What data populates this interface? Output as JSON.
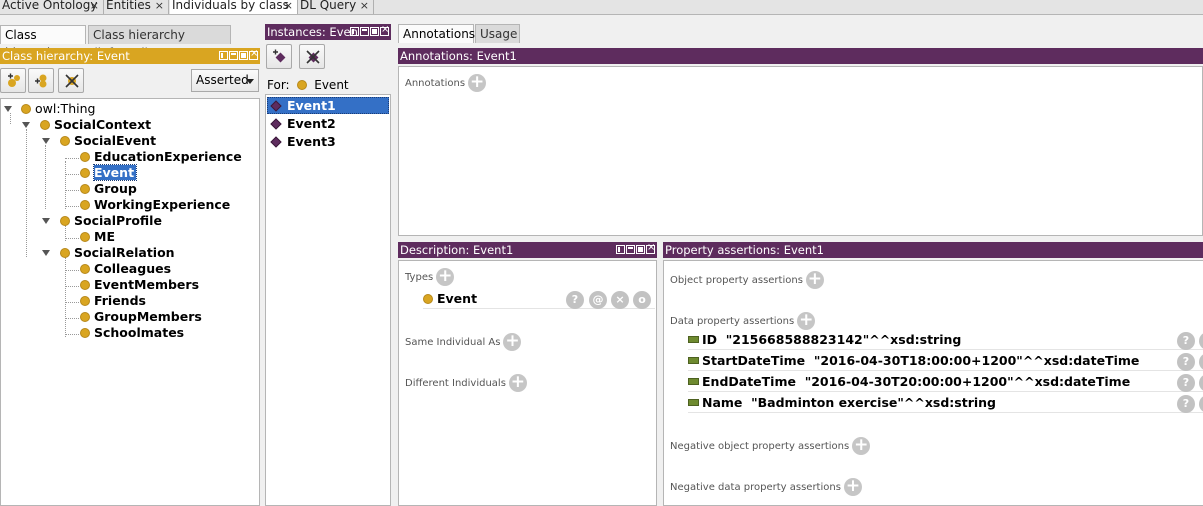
{
  "top_tabs": [
    {
      "label": "Active Ontology"
    },
    {
      "label": "Entities"
    },
    {
      "label": "Individuals by class"
    },
    {
      "label": "DL Query"
    }
  ],
  "left": {
    "tabs": [
      "Class hierarchy",
      "Class hierarchy (inferred)"
    ],
    "header": "Class hierarchy: Event",
    "dropdown": "Asserted",
    "tree": {
      "root": "owl:Thing",
      "social_context": "SocialContext",
      "social_event": "SocialEvent",
      "education_experience": "EducationExperience",
      "event": "Event",
      "group": "Group",
      "working_experience": "WorkingExperience",
      "social_profile": "SocialProfile",
      "me": "ME",
      "social_relation": "SocialRelation",
      "colleagues": "Colleagues",
      "event_members": "EventMembers",
      "friends": "Friends",
      "group_members": "GroupMembers",
      "schoolmates": "Schoolmates"
    }
  },
  "instances": {
    "header": "Instances: Even",
    "for_label": "For:",
    "for_class": "Event",
    "items": [
      "Event1",
      "Event2",
      "Event3"
    ]
  },
  "right": {
    "tabs": [
      "Annotations",
      "Usage"
    ],
    "annotations_header": "Annotations: Event1",
    "annotations_label": "Annotations",
    "description_header": "Description: Event1",
    "types_label": "Types",
    "type_value": "Event",
    "same_individual_label": "Same Individual As",
    "different_individuals_label": "Different Individuals",
    "property_header": "Property assertions: Event1",
    "object_property_label": "Object property assertions",
    "data_property_label": "Data property assertions",
    "data_props": [
      {
        "name": "ID",
        "value": "\"215668588823142\"^^xsd:string"
      },
      {
        "name": "StartDateTime",
        "value": "\"2016-04-30T18:00:00+1200\"^^xsd:dateTime"
      },
      {
        "name": "EndDateTime",
        "value": "\"2016-04-30T20:00:00+1200\"^^xsd:dateTime"
      },
      {
        "name": "Name",
        "value": "\"Badminton exercise\"^^xsd:string"
      }
    ],
    "negative_object_label": "Negative object property assertions",
    "negative_data_label": "Negative data property assertions",
    "action_glyphs": {
      "help": "?",
      "annotate": "@",
      "delete": "×",
      "edit": "o"
    }
  },
  "colors": {
    "panel_header": "#5e2c5e",
    "class_header": "#d9a521",
    "selection": "#3470c6",
    "class_dot": "#d9a521",
    "data_prop": "#6e8a2f"
  }
}
